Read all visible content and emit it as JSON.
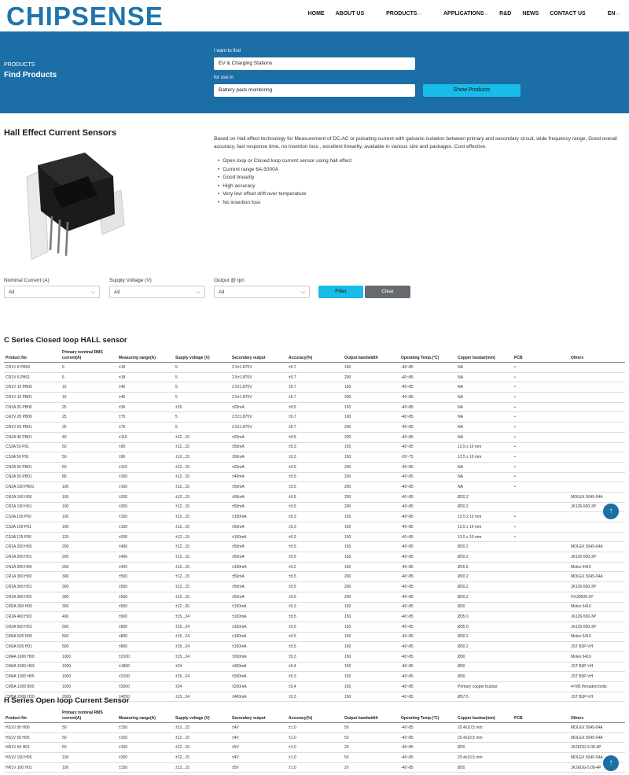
{
  "header": {
    "logo": "CHIPSENSE",
    "menu": [
      "HOME",
      "ABOUT US",
      "PRODUCTS",
      "APPLICATIONS",
      "R&D",
      "NEWS",
      "CONTACT US",
      "EN"
    ]
  },
  "banner": {
    "subtitle": "PRODUCTS",
    "title": "Find Products",
    "find_label": "I want to find",
    "find_value": "EV & Charging Stations",
    "use_label": "for use in",
    "use_value": "Battery pack monitoring",
    "button": "Show Products"
  },
  "section": {
    "title": "Hall Effect Current Sensors",
    "description": "Based on Hall effect technology for Measurement of DC,AC or pulsating current with galvanic isolation between primary and secondary circuit, wide frequency range, Good overall accuracy, fast response time, no insertion loss , excellent linearity, available in various size and packages. Cost effective.",
    "features": [
      "Open loop or Closed loop current sensor using hall effect",
      "Current range 6A-5000A",
      "Good linearity",
      "High accuracy",
      "Very low offset drift over temperature",
      "No insertion loss"
    ]
  },
  "filters": {
    "nominal_label": "Nominal Current (A)",
    "supply_label": "Supply Voltage (V)",
    "output_label": "Output @ Ipn",
    "all": "All",
    "filter_btn": "Filter",
    "clear_btn": "Clear"
  },
  "columns": [
    "Product No",
    "Primary nominal RMS current(A)",
    "Measuring range(A)",
    "Supply voltage (V)",
    "Secondary output",
    "Accuracy(%)",
    "Output bandwidth",
    "Operating Temp.(°C)",
    "Copper busbar(mm)",
    "PCB",
    "Others"
  ],
  "c_series": {
    "title": "C Series Closed loop HALL sensor",
    "rows": [
      [
        "CR1V 6 PB00",
        "6",
        "±18",
        "5",
        "2.5±1.875V",
        "±0.7",
        "100",
        "-40~85",
        "NA",
        "•",
        ""
      ],
      [
        "CR1V 6 PB01",
        "6",
        "±18",
        "5",
        "2.5±1.875V",
        "±0.7",
        "200",
        "-40~85",
        "NA",
        "•",
        ""
      ],
      [
        "CR1V 15 PB00",
        "15",
        "±45",
        "5",
        "2.5±1.875V",
        "±0.7",
        "100",
        "-40~85",
        "NA",
        "•",
        ""
      ],
      [
        "CR1V 15 PB01",
        "15",
        "±45",
        "5",
        "2.5±1.875V",
        "±0.7",
        "200",
        "-40~85",
        "NA",
        "•",
        ""
      ],
      [
        "CN1A 25 PB00",
        "25",
        "±36",
        "±15",
        "±25mA",
        "±0.5",
        "150",
        "-40~85",
        "NA",
        "•",
        ""
      ],
      [
        "CR1V 25 PB00",
        "25",
        "±75",
        "5",
        "2.5±1.875V",
        "±0.7",
        "100",
        "-40~85",
        "NA",
        "•",
        ""
      ],
      [
        "CR1V 25 PB01",
        "25",
        "±75",
        "5",
        "2.5±1.875V",
        "±0.7",
        "200",
        "-40~85",
        "NA",
        "•",
        ""
      ],
      [
        "CN2A 40 PB01",
        "40",
        "±110",
        "±12...15",
        "±20mA",
        "±0.5",
        "200",
        "-40~85",
        "NA",
        "•",
        ""
      ],
      [
        "CS3A 50 P01",
        "50",
        "±90",
        "±12...15",
        "±50mA",
        "±0.3",
        "150",
        "-40~85",
        "13.5 x 10 mm",
        "•",
        ""
      ],
      [
        "CS3A 50 P51",
        "50",
        "±90",
        "±12...15",
        "±50mA",
        "±0.3",
        "150",
        "-20~75",
        "13.5 x 10 mm",
        "•",
        ""
      ],
      [
        "CN2A 50 PB01",
        "50",
        "±110",
        "±12...15",
        "±25mA",
        "±0.5",
        "200",
        "-40~85",
        "NA",
        "•",
        ""
      ],
      [
        "CN2A 50 PB01",
        "80",
        "±160",
        "±12...15",
        "±40mA",
        "±0.5",
        "200",
        "-40~85",
        "NA",
        "•",
        ""
      ],
      [
        "CN2A 100 PB01",
        "100",
        "±160",
        "±12...15",
        "±50mA",
        "±0.5",
        "200",
        "-40~85",
        "NA",
        "•",
        ""
      ],
      [
        "CR1A 100 H00",
        "100",
        "±200",
        "±12...15",
        "±50mA",
        "±0.5",
        "200",
        "-40~85",
        "Ø20.2",
        "",
        "MOLEX 5045-04A"
      ],
      [
        "CR1A 100 H01",
        "100",
        "±200",
        "±12...15",
        "±50mA",
        "±0.5",
        "200",
        "-40~85",
        "Ø20.2",
        "",
        "JK126-500-3P"
      ],
      [
        "CS3A 100 P00",
        "100",
        "±150",
        "±12...15",
        "±100mA",
        "±0.3",
        "150",
        "-40~85",
        "13.5 x 10 mm",
        "•",
        ""
      ],
      [
        "CS3A 100 P01",
        "100",
        "±150",
        "±12...15",
        "±50mA",
        "±0.3",
        "150",
        "-40~85",
        "13.5 x 10 mm",
        "•",
        ""
      ],
      [
        "CS3A 125 P00",
        "125",
        "±200",
        "±12...15",
        "±100mA",
        "±0.3",
        "150",
        "-40~85",
        "13.5 x 10 mm",
        "•",
        ""
      ],
      [
        "CR1A 200 H00",
        "200",
        "±400",
        "±12...15",
        "±50mA",
        "±0.5",
        "150",
        "-40~85",
        "Ø20.2",
        "",
        "MOLEX 5045-04A"
      ],
      [
        "CR1A 200 H01",
        "200",
        "±400",
        "±12...15",
        "±50mA",
        "±0.5",
        "150",
        "-40~85",
        "Ø20.2",
        "",
        "JK126-500-3P"
      ],
      [
        "CN1A 200 H00",
        "200",
        "±420",
        "±12...15",
        "±100mA",
        "±0.2",
        "100",
        "-40~85",
        "Ø15.6",
        "",
        "Molex 6410"
      ],
      [
        "CR1A 300 H00",
        "300",
        "±500",
        "±12...15",
        "±50mA",
        "±0.5",
        "200",
        "-40~85",
        "Ø20.2",
        "",
        "MOLEX 5045-04A"
      ],
      [
        "CR1A 300 H01",
        "300",
        "±500",
        "±12...15",
        "±50mA",
        "±0.5",
        "200",
        "-40~85",
        "Ø20.2",
        "",
        "JK126-500-3P"
      ],
      [
        "CR1A 300 H02",
        "300",
        "±500",
        "±12...15",
        "±50mA",
        "±0.5",
        "200",
        "-40~85",
        "Ø20.2",
        "",
        "HX35600-3Y"
      ],
      [
        "CM2A 300 H00",
        "300",
        "±500",
        "±12...20",
        "±150mA",
        "±0.3",
        "150",
        "-40~85",
        "Ø20",
        "",
        "Molex 6410"
      ],
      [
        "CR2A 400 H03",
        "400",
        "±600",
        "±15...24",
        "±100mA",
        "±0.5",
        "150",
        "-40~85",
        "Ø35.0",
        "",
        "JK126-500-3P"
      ],
      [
        "CR2A 500 H03",
        "500",
        "±800",
        "±15...24",
        "±100mA",
        "±0.5",
        "150",
        "-40~85",
        "Ø35.0",
        "",
        "JK126-500-3P"
      ],
      [
        "CM3A 500 H00",
        "500",
        "±800",
        "±15...24",
        "±100mA",
        "±0.5",
        "100",
        "-40~85",
        "Ø30.2",
        "",
        "Molex 6410"
      ],
      [
        "CM3A 500 H01",
        "500",
        "±800",
        "±15...24",
        "±100mA",
        "±0.5",
        "100",
        "-40~85",
        "Ø30.2",
        "",
        "JST B3P-VH"
      ],
      [
        "CM4A 1000 H00",
        "1000",
        "±2100",
        "±15...24",
        "±200mA",
        "±0.3",
        "150",
        "-40~85",
        "Ø30",
        "",
        "Molex 6410"
      ],
      [
        "CM4A 1000 H03",
        "1000",
        "±1800",
        "±24",
        "±300mA",
        "±0.4",
        "150",
        "-40~85",
        "Ø30",
        "",
        "JST B3P-VH"
      ],
      [
        "CM4A 1000 H05",
        "1000",
        "±2100",
        "±15...24",
        "±200mA",
        "±0.3",
        "150",
        "-40~85",
        "Ø30",
        "",
        "JST B3P-VH"
      ],
      [
        "CM5A 1000 B00",
        "1000",
        "±3000",
        "±24",
        "±200mA",
        "±0.4",
        "150",
        "-40~85",
        "Primary copper busbar",
        "",
        "4×M5 threaded bolts"
      ],
      [
        "CM5A 2000 H20",
        "2000",
        "±4250",
        "±15...24",
        "±400mA",
        "±0.3",
        "150",
        "-40~85",
        "Ø57.5",
        "",
        "JST B3P-VH"
      ]
    ]
  },
  "h_series": {
    "title": "H Series Open loop Current Sensor",
    "rows": [
      [
        "HS1V 50 H00",
        "50",
        "±150",
        "±12...15",
        "±4V",
        "±1.0",
        "50",
        "-40~85",
        "20.4x10.5 mm",
        "",
        "MOLEX 5045-04A"
      ],
      [
        "HS1V 50 H05",
        "50",
        "±150",
        "±12...15",
        "±4V",
        "±1.0",
        "50",
        "-40~85",
        "20.4x10.5 mm",
        "",
        "MOLEX 5045-04A"
      ],
      [
        "HR1V 50 H01",
        "50",
        "±100",
        "±12...15",
        "±5V",
        "±1.0",
        "20",
        "-40~85",
        "Ø20",
        "",
        "JK2EDG-5.08-4P"
      ],
      [
        "HS1V 100 H05",
        "100",
        "±300",
        "±12...15",
        "±4V",
        "±1.0",
        "50",
        "-40~85",
        "20.4x10.5 mm",
        "",
        "MOLEX 5045-04A"
      ],
      [
        "HR1V 100 H01",
        "100",
        "±150",
        "±12...15",
        "±5V",
        "±1.0",
        "20",
        "-40~85",
        "Ø20",
        "",
        "JK2EDG-5.08-4P"
      ]
    ]
  },
  "scroll_top": "↑"
}
